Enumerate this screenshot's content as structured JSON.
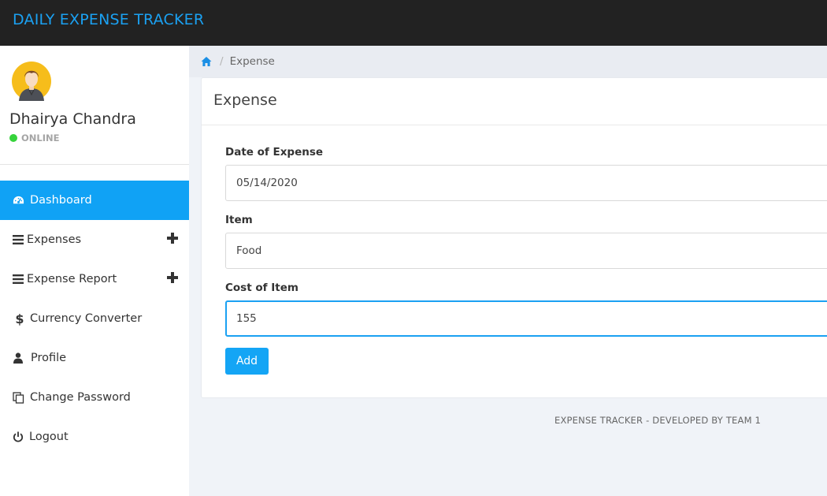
{
  "app": {
    "title": "DAILY EXPENSE TRACKER",
    "brand_color": "#1ba1f2",
    "accent_color": "#10a2f5"
  },
  "user": {
    "name": "Dhairya Chandra",
    "status": "ONLINE",
    "status_color": "#36d33b",
    "avatar_icon": "user-avatar-icon"
  },
  "sidebar": {
    "items": [
      {
        "label": "Dashboard",
        "icon": "dashboard-icon",
        "active": true
      },
      {
        "label": "Expenses",
        "icon": "list-icon",
        "expandable": true
      },
      {
        "label": "Expense Report",
        "icon": "list-icon",
        "expandable": true
      },
      {
        "label": "Currency Converter",
        "icon": "dollar-icon"
      },
      {
        "label": "Profile",
        "icon": "user-icon"
      },
      {
        "label": "Change Password",
        "icon": "copy-icon"
      },
      {
        "label": "Logout",
        "icon": "power-icon"
      }
    ]
  },
  "breadcrumb": {
    "home_icon": "home-icon",
    "current": "Expense"
  },
  "form": {
    "title": "Expense",
    "date_label": "Date of Expense",
    "date_value": "05/14/2020",
    "item_label": "Item",
    "item_value": "Food",
    "cost_label": "Cost of Item",
    "cost_value": "155",
    "submit_label": "Add"
  },
  "footer": {
    "text": "EXPENSE TRACKER - DEVELOPED BY TEAM 1"
  }
}
